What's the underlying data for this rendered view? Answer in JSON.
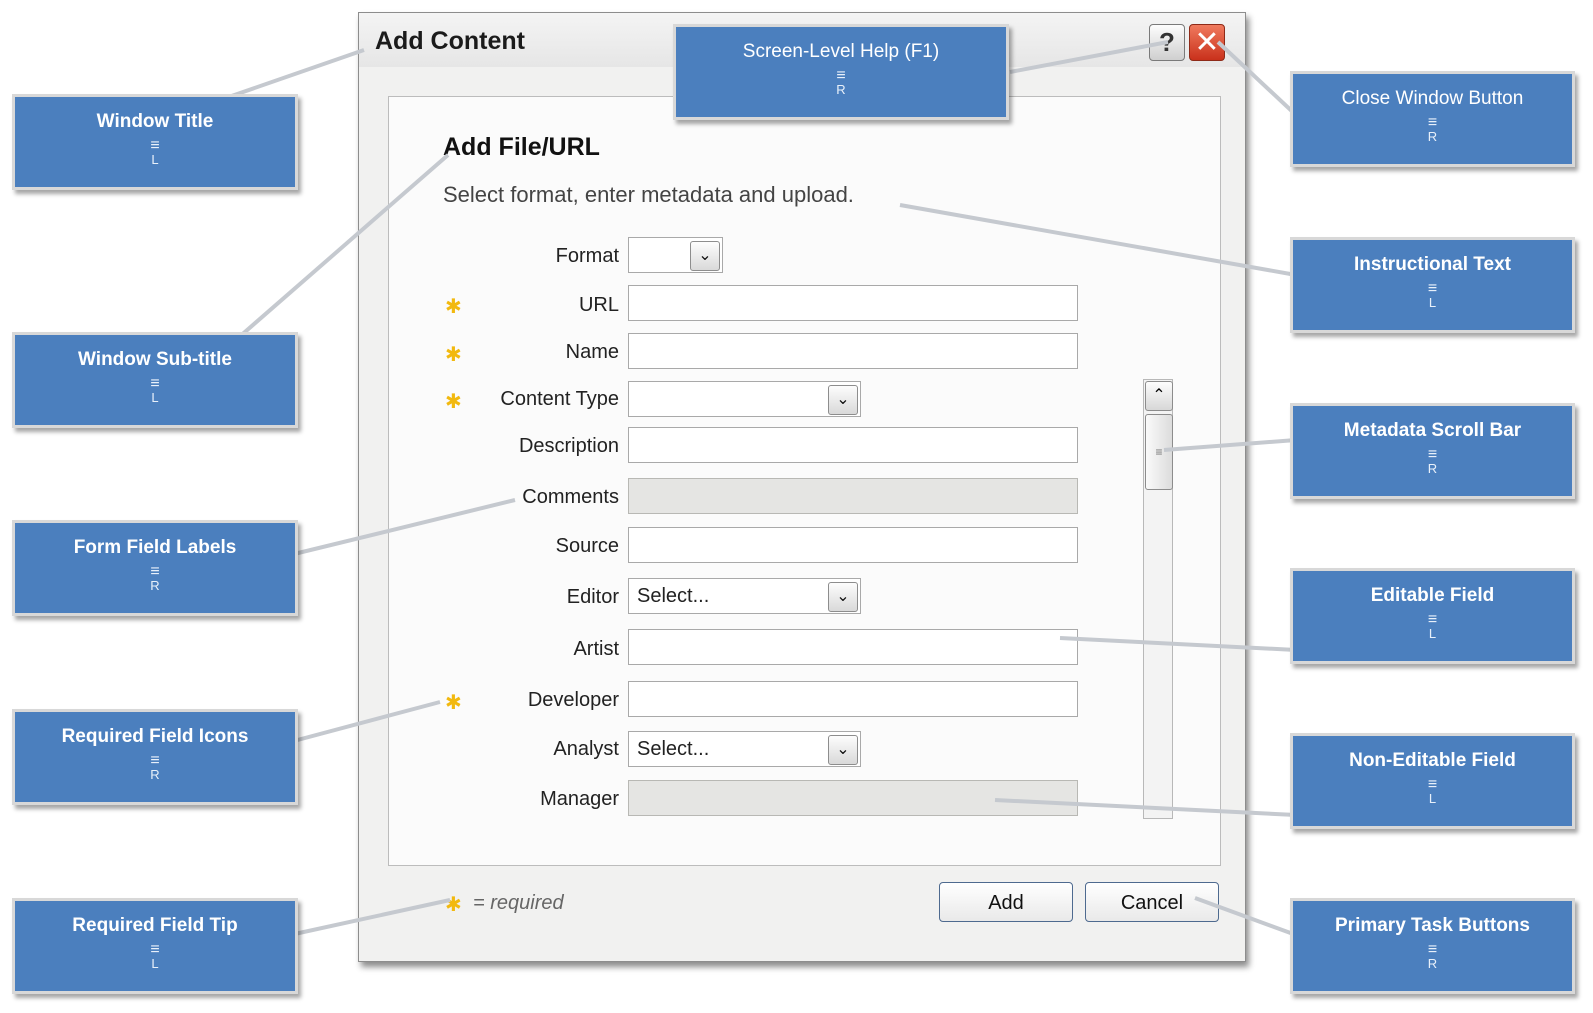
{
  "dialog": {
    "title": "Add Content",
    "help_glyph": "?",
    "close_glyph": "✕",
    "subtitle": "Add File/URL",
    "instruction": "Select format, enter metadata and upload.",
    "required_tip": "= required",
    "required_star": "✱",
    "buttons": {
      "add": "Add",
      "cancel": "Cancel"
    },
    "fields": [
      {
        "label": "Format",
        "required": false,
        "type": "select",
        "value": ""
      },
      {
        "label": "URL",
        "required": true,
        "type": "text",
        "value": ""
      },
      {
        "label": "Name",
        "required": true,
        "type": "text",
        "value": ""
      },
      {
        "label": "Content Type",
        "required": true,
        "type": "select",
        "value": ""
      },
      {
        "label": "Description",
        "required": false,
        "type": "text",
        "value": ""
      },
      {
        "label": "Comments",
        "required": false,
        "type": "text-disabled",
        "value": ""
      },
      {
        "label": "Source",
        "required": false,
        "type": "text",
        "value": ""
      },
      {
        "label": "Editor",
        "required": false,
        "type": "select",
        "value": "Select..."
      },
      {
        "label": "Artist",
        "required": false,
        "type": "text",
        "value": ""
      },
      {
        "label": "Developer",
        "required": true,
        "type": "text",
        "value": ""
      },
      {
        "label": "Analyst",
        "required": false,
        "type": "select",
        "value": "Select..."
      },
      {
        "label": "Manager",
        "required": false,
        "type": "text-disabled",
        "value": ""
      }
    ]
  },
  "callouts": {
    "window_title": {
      "text": "Window Title",
      "align": "L"
    },
    "window_subtitle": {
      "text": "Window Sub-title",
      "align": "L"
    },
    "form_field_labels": {
      "text": "Form Field Labels",
      "align": "R"
    },
    "required_field_icons": {
      "text": "Required Field Icons",
      "align": "R"
    },
    "required_field_tip": {
      "text": "Required Field Tip",
      "align": "L"
    },
    "screen_level_help": {
      "text": "Screen-Level Help (F1)",
      "align": "R"
    },
    "close_window_button": {
      "text": "Close Window Button",
      "align": "R"
    },
    "instructional_text": {
      "text": "Instructional Text",
      "align": "L"
    },
    "metadata_scroll_bar": {
      "text": "Metadata Scroll Bar",
      "align": "R"
    },
    "editable_field": {
      "text": "Editable Field",
      "align": "L"
    },
    "non_editable_field": {
      "text": "Non-Editable Field",
      "align": "L"
    },
    "primary_task_buttons": {
      "text": "Primary Task Buttons",
      "align": "R"
    }
  },
  "icons": {
    "align_lines": "≡",
    "dropdown_arrow": "⌄",
    "scroll_up": "⌃"
  },
  "colors": {
    "callout_fill": "#4b7fbe",
    "required_star": "#f2b90f",
    "close_button": "#d9442a"
  }
}
